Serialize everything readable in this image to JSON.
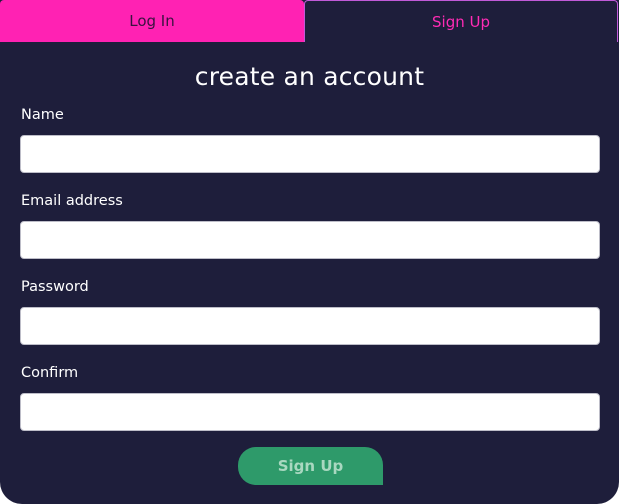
{
  "tabs": {
    "login_label": "Log In",
    "signup_label": "Sign Up",
    "active": "signup"
  },
  "form": {
    "title": "create an account",
    "fields": [
      {
        "label": "Name",
        "value": "",
        "placeholder": ""
      },
      {
        "label": "Email address",
        "value": "",
        "placeholder": ""
      },
      {
        "label": "Password",
        "value": "",
        "placeholder": ""
      },
      {
        "label": "Confirm",
        "value": "",
        "placeholder": ""
      }
    ],
    "submit_label": "Sign Up"
  },
  "colors": {
    "background": "#1e1e3b",
    "login_tab": "#ff22b3",
    "signup_tab_text": "#ff2bb5",
    "submit_button": "#2e9a6a",
    "label_text": "#ffffff"
  }
}
